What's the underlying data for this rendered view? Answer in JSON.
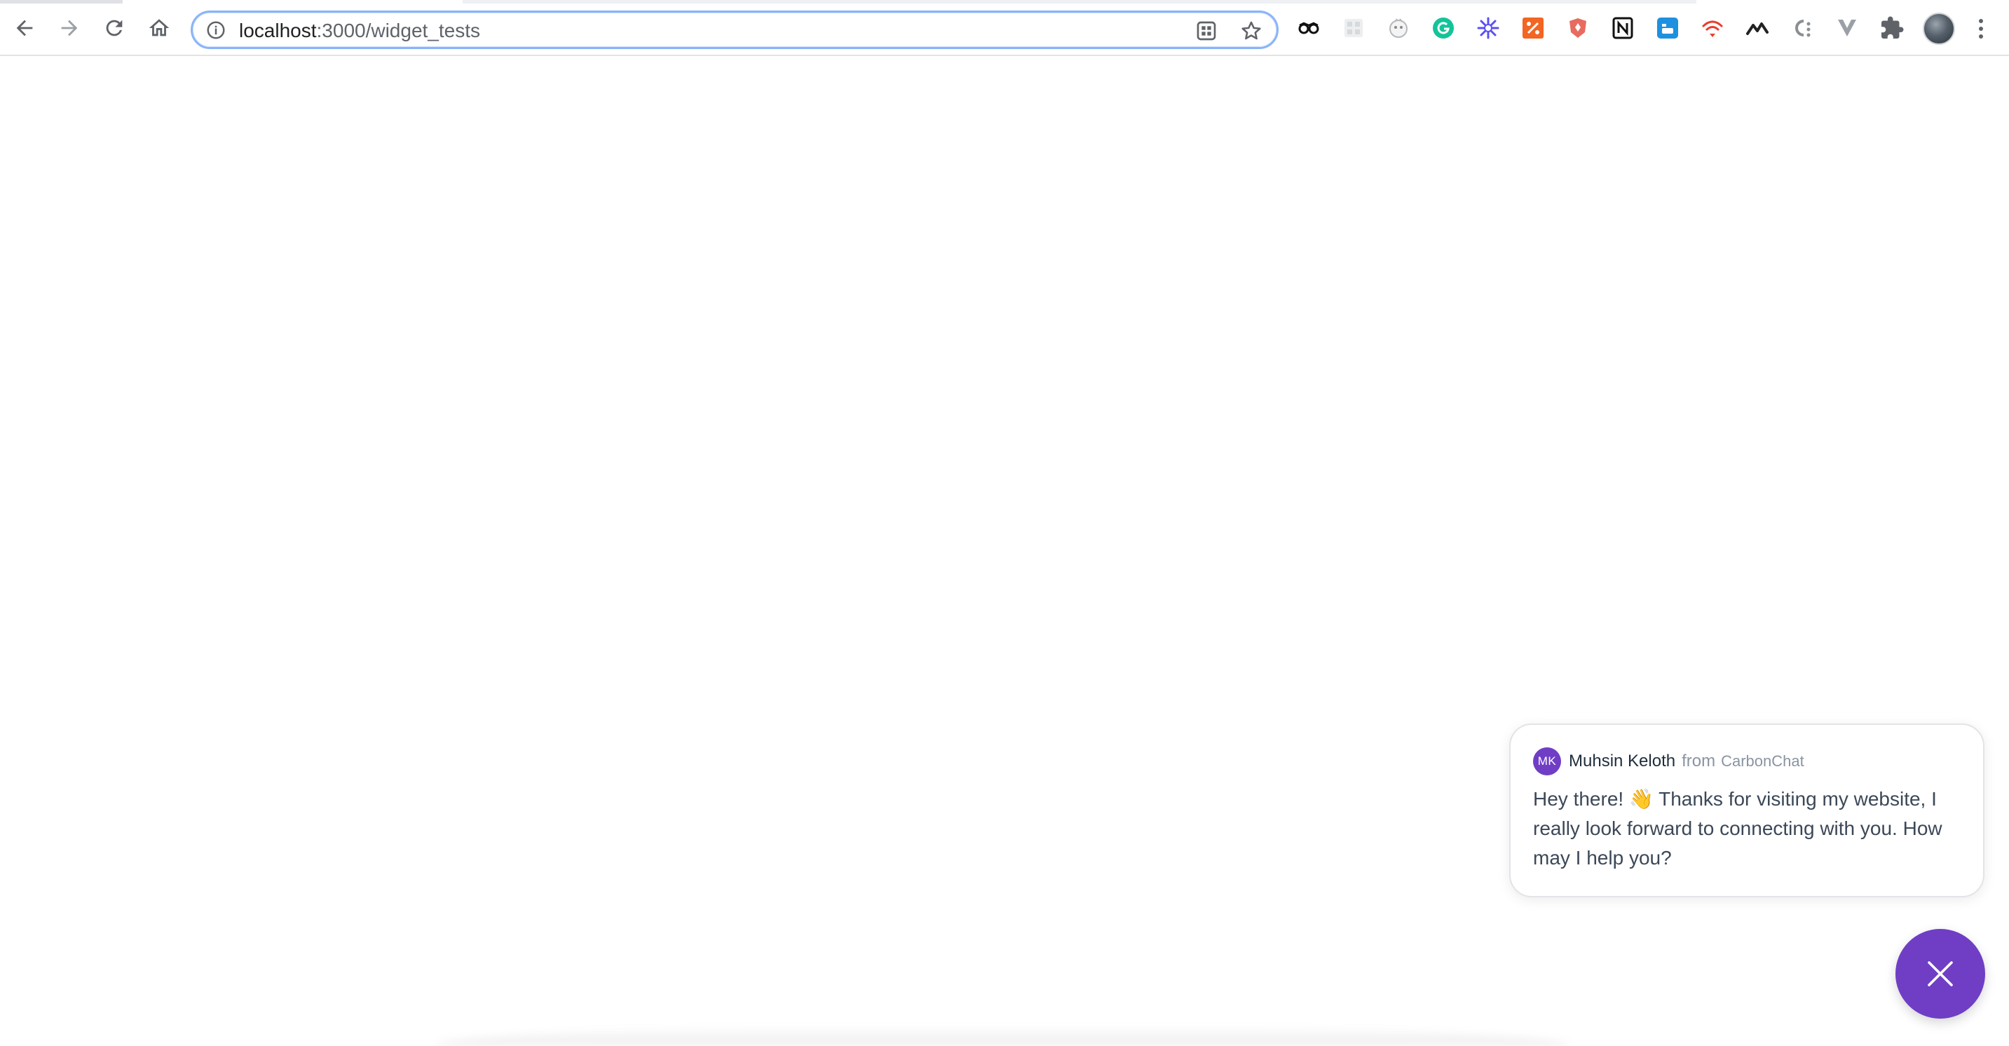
{
  "browser": {
    "url_host": "localhost",
    "url_path": ":3000/widget_tests",
    "nav": {
      "back_icon": "arrow-left-icon",
      "forward_icon": "arrow-right-icon",
      "reload_icon": "reload-icon",
      "home_icon": "home-icon"
    },
    "omnibox_icons": [
      "info-icon",
      "qr-grid-icon",
      "star-icon"
    ],
    "extensions": [
      {
        "name": "glasses-extension-icon"
      },
      {
        "name": "grid-extension-icon"
      },
      {
        "name": "face-extension-icon"
      },
      {
        "name": "grammarly-extension-icon",
        "color": "#15c39a"
      },
      {
        "name": "asterisk-extension-icon",
        "color": "#5b4ff5"
      },
      {
        "name": "percent-extension-icon",
        "color": "#f26522"
      },
      {
        "name": "shield-extension-icon",
        "color": "#e86b5f"
      },
      {
        "name": "notion-extension-icon",
        "color": "#111111"
      },
      {
        "name": "blue-square-extension-icon",
        "color": "#1e90e0"
      },
      {
        "name": "red-wifi-extension-icon",
        "color": "#e8402e"
      },
      {
        "name": "wave-extension-icon",
        "color": "#222222"
      },
      {
        "name": "c-dots-extension-icon",
        "color": "#8a8f94"
      },
      {
        "name": "v-extension-icon",
        "color": "#9aa0a6"
      },
      {
        "name": "puzzle-extensions-icon",
        "color": "#5f6368"
      }
    ],
    "profile_icon": "profile-avatar",
    "menu_icon": "kebab-menu-icon"
  },
  "chat": {
    "avatar_initials": "MK",
    "agent_name": "Muhsin Keloth",
    "from_label": "from",
    "org_name": "CarbonChat",
    "message": "Hey there! 👋 Thanks for visiting my website, I really look forward to connecting with you. How may I help you?",
    "close_icon": "close-icon",
    "accent_color": "#6f3ec5"
  }
}
